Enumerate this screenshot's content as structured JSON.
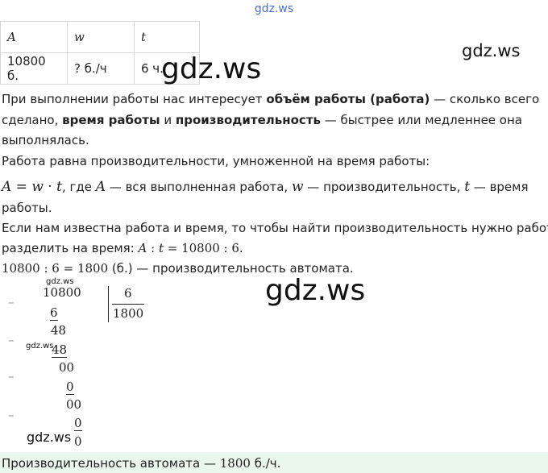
{
  "watermarks": {
    "top": "gdz.ws",
    "table_big": "gdz.ws",
    "right": "gdz.ws",
    "middle_big": "gdz.ws",
    "small_1": "gdz.ws",
    "small_2": "gdz.ws",
    "bottom_left": "gdz.ws"
  },
  "table": {
    "headers": [
      "A",
      "w",
      "t"
    ],
    "row": [
      "10800 б.",
      "? б./ч",
      "6 ч."
    ]
  },
  "text": {
    "p1_a": "При выполнении работы нас интересует ",
    "p1_b": "объём работы (работа)",
    "p1_c": " — сколько всего",
    "p2_a": "сделано, ",
    "p2_b": "время работы",
    "p2_c": " и ",
    "p2_d": "производительность",
    "p2_e": " — быстрее или медленнее она",
    "p3": "выполнялась.",
    "p4": "Работа равна производительности, умноженной на время работы:",
    "f1_a": "A",
    "f1_eq": " = ",
    "f1_w": "w",
    "f1_dot": " · ",
    "f1_t": "t",
    "f1_rest_1": ", где ",
    "f1_A2": "A",
    "f1_rest_2": " — вся выполненная работа, ",
    "f1_w2": "w",
    "f1_rest_3": " — производительность, ",
    "f1_t2": "t",
    "f1_rest_4": " — время",
    "p5": "работы.",
    "p6": "Если нам известна работа и время, то чтобы найти производительность нужно работу",
    "p7_a": "разделить на время: ",
    "p7_A": "A",
    "p7_b": " : ",
    "p7_t": "t",
    "p7_c": " = 10800 : 6.",
    "p8_a": "10800 : 6 = 1800",
    "p8_b": " (б.) — производительность автомата.",
    "answer_a": "Производительность автомата — ",
    "answer_b": "1800",
    "answer_c": " б./ч."
  },
  "division": {
    "dividend": "10800",
    "divisor": "6",
    "quotient": "1800",
    "steps": [
      "6",
      "48",
      "48",
      "00",
      "0",
      "00",
      "0",
      "0"
    ],
    "minus": "–"
  }
}
